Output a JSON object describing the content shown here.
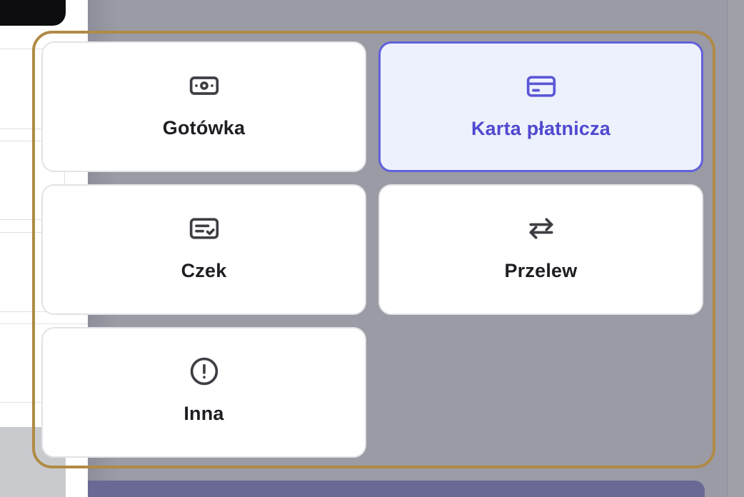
{
  "colors": {
    "selected_border": "#6160dc",
    "selected_background": "#edf1fd",
    "selected_text": "#5049cf",
    "highlight_frame": "#b08a46",
    "overlay": "#9a9ba4"
  },
  "payment_methods": [
    {
      "label": "Gotówka",
      "icon": "banknote-icon",
      "selected": false
    },
    {
      "label": "Karta płatnicza",
      "icon": "credit-card-icon",
      "selected": true
    },
    {
      "label": "Czek",
      "icon": "check-icon",
      "selected": false
    },
    {
      "label": "Przelew",
      "icon": "transfer-arrows-icon",
      "selected": false
    },
    {
      "label": "Inna",
      "icon": "alert-circle-icon",
      "selected": false
    }
  ]
}
